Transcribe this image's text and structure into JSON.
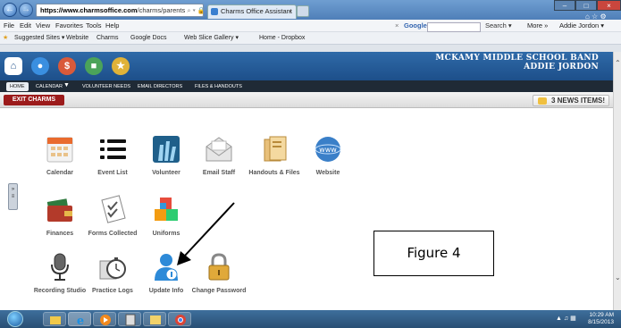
{
  "browser": {
    "address_host": "https://www.charmsoffice.com",
    "address_tail": "/charms/parents",
    "address_ctrls": "⌕ ▾ 🔒 ↔ ↻",
    "tab_title": "Charms Office Assistant",
    "menu": [
      "File",
      "Edit",
      "View",
      "Favorites",
      "Tools",
      "Help"
    ],
    "favorites": [
      "Suggested Sites ▾",
      "Website",
      "Charms",
      "Google Docs",
      "Web Slice Gallery ▾",
      "Home - Dropbox"
    ],
    "search_engine": "Google",
    "search_button": "Search ▾",
    "more_label": "More »",
    "user_label": "Addie Jordon ▾"
  },
  "site": {
    "school": "MCKAMY MIDDLE SCHOOL BAND",
    "student": "ADDIE JORDON",
    "nav_tabs": [
      "HOME",
      "CALENDAR",
      "VOLUNTEER NEEDS",
      "EMAIL DIRECTORS",
      "FILES & HANDOUTS"
    ],
    "exit_label": "EXIT CHARMS",
    "news_label": "3 NEWS ITEMS!"
  },
  "tiles": [
    {
      "label": "Calendar",
      "icon": "calendar-icon"
    },
    {
      "label": "Event List",
      "icon": "list-icon"
    },
    {
      "label": "Volunteer",
      "icon": "volunteer-icon"
    },
    {
      "label": "Email Staff",
      "icon": "envelope-icon"
    },
    {
      "label": "Handouts & Files",
      "icon": "files-icon"
    },
    {
      "label": "Website",
      "icon": "globe-icon"
    },
    {
      "label": "Finances",
      "icon": "wallet-icon"
    },
    {
      "label": "Forms Collected",
      "icon": "forms-icon"
    },
    {
      "label": "Uniforms",
      "icon": "uniform-icon"
    },
    {
      "label": "Recording Studio",
      "icon": "microphone-icon"
    },
    {
      "label": "Practice Logs",
      "icon": "stopwatch-icon"
    },
    {
      "label": "Update Info",
      "icon": "person-icon"
    },
    {
      "label": "Change Password",
      "icon": "padlock-icon"
    }
  ],
  "figure_label": "Figure 4",
  "taskbar": {
    "time": "10:29 AM",
    "date": "8/15/2013"
  },
  "colors": {
    "site_header": "#1d4f8a",
    "exit_button": "#9c1b1b",
    "update_info_icon": "#2d8ad8"
  }
}
